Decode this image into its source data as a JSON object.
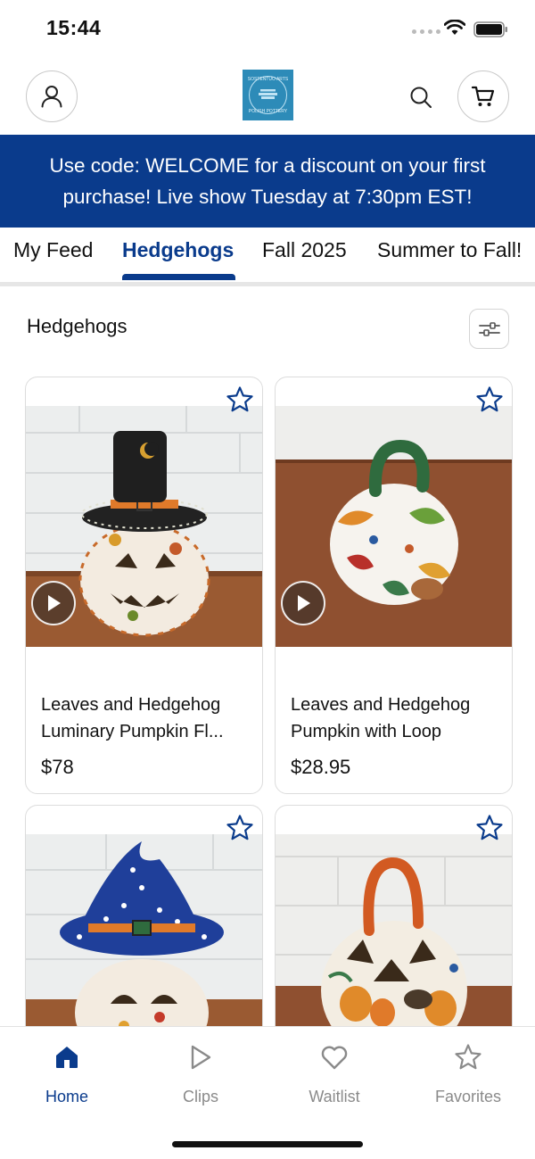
{
  "status_bar": {
    "time": "15:44"
  },
  "header": {
    "logo_text": "SOSTENTUO ARTS · POLISH POTTERY"
  },
  "banner": {
    "text": "Use code: WELCOME for a discount on your first purchase! Live show Tuesday at 7:30pm EST!"
  },
  "tabs": [
    {
      "label": "My Feed",
      "active": false
    },
    {
      "label": "Hedgehogs",
      "active": true
    },
    {
      "label": "Fall 2025",
      "active": false
    },
    {
      "label": "Summer to Fall!",
      "active": false
    }
  ],
  "section": {
    "title": "Hedgehogs"
  },
  "products": [
    {
      "title": "Leaves and Hedgehog Luminary Pumpkin Fl...",
      "price": "$78",
      "has_video": true
    },
    {
      "title": "Leaves and Hedgehog Pumpkin with Loop",
      "price": "$28.95",
      "has_video": true
    },
    {
      "title": "",
      "price": "",
      "has_video": false
    },
    {
      "title": "",
      "price": "",
      "has_video": false
    }
  ],
  "tabbar": [
    {
      "label": "Home",
      "icon": "home-icon",
      "active": true
    },
    {
      "label": "Clips",
      "icon": "play-icon",
      "active": false
    },
    {
      "label": "Waitlist",
      "icon": "heart-icon",
      "active": false
    },
    {
      "label": "Favorites",
      "icon": "star-icon",
      "active": false
    }
  ],
  "colors": {
    "brand": "#0a3b8c",
    "inactive": "#8a8a8a",
    "logo_bg": "#2d8bb8"
  }
}
